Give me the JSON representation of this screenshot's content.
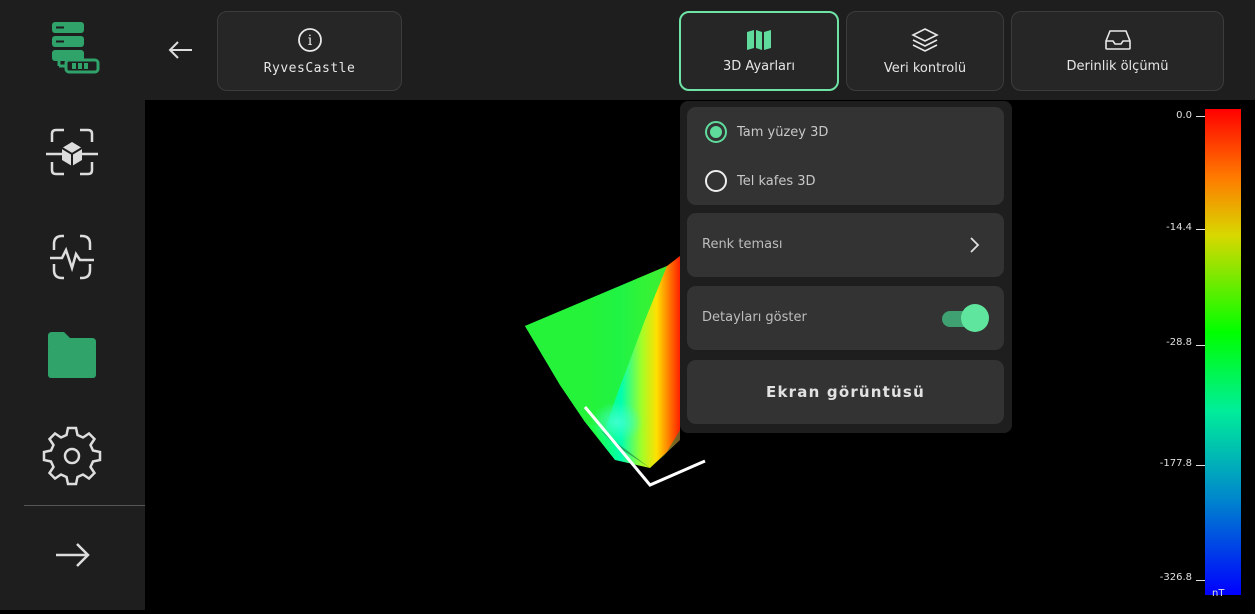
{
  "project": {
    "name": "RyvesCastle"
  },
  "toolbar": {
    "settings_3d": "3D Ayarları",
    "data_control": "Veri kontrolü",
    "depth_measure": "Derinlik ölçümü"
  },
  "panel": {
    "options": [
      {
        "label": "Tam yüzey 3D",
        "selected": true
      },
      {
        "label": "Tel kafes 3D",
        "selected": false
      }
    ],
    "color_theme": "Renk teması",
    "show_details": "Detayları göster",
    "show_details_on": true,
    "screenshot": "Ekran görüntüsü"
  },
  "scale": {
    "ticks": [
      "0.0",
      "-14.4",
      "-28.8",
      "-177.8",
      "-326.8"
    ],
    "unit": "nT"
  },
  "colors": {
    "accent": "#6fe3a6",
    "background": "#000000",
    "panel": "#1e1e1e"
  }
}
